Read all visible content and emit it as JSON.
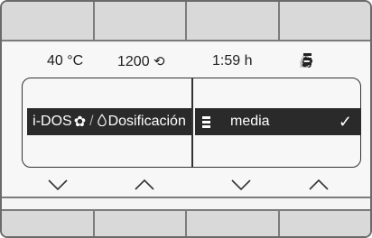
{
  "status": {
    "temperature": "40 °C",
    "spin": "1200",
    "spin_icon": "spin-icon",
    "time": "1:59 h",
    "icons": [
      "flower-icon",
      "drop-icon",
      "level-icon"
    ]
  },
  "option": {
    "label_prefix": "i-DOS",
    "label_suffix": "Dosificación",
    "value": "media",
    "icons": [
      "flower-icon",
      "drop-icon",
      "level-icon",
      "check-icon"
    ]
  },
  "controls": [
    "chevron-down-icon",
    "chevron-up-icon",
    "chevron-down-icon",
    "chevron-up-icon"
  ]
}
